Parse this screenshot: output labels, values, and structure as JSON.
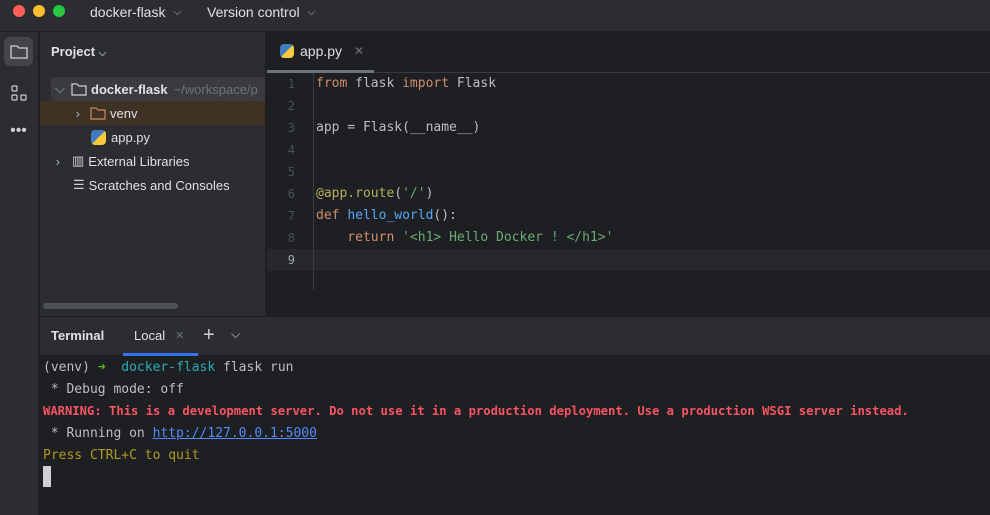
{
  "titlebar": {
    "project": "docker-flask",
    "vcs": "Version control"
  },
  "project_panel": {
    "title": "Project",
    "tree": [
      {
        "label": "docker-flask",
        "path": "~/workspace/p"
      },
      {
        "label": "venv"
      },
      {
        "label": "app.py"
      },
      {
        "label": "External Libraries"
      },
      {
        "label": "Scratches and Consoles"
      }
    ]
  },
  "editor": {
    "tab": "app.py",
    "line_numbers": [
      "1",
      "2",
      "3",
      "4",
      "5",
      "6",
      "7",
      "8",
      "9"
    ],
    "code": {
      "l1a": "from",
      "l1b": " flask ",
      "l1c": "import",
      "l1d": " Flask",
      "l3": "app = Flask(__name__)",
      "l6a": "@app.route",
      "l6b": "(",
      "l6c": "'/'",
      "l6d": ")",
      "l7a": "def",
      "l7b": " ",
      "l7c": "hello_world",
      "l7d": "():",
      "l8a": "    return",
      "l8b": " ",
      "l8c": "'<h1> Hello Docker ! </h1>'"
    }
  },
  "terminal": {
    "title": "Terminal",
    "tab": "Local",
    "prompt_env": "(venv) ",
    "prompt_arrow": "➜",
    "prompt_dir": "docker-flask",
    "prompt_cmd": " flask run",
    "line2": " * Debug mode: off",
    "line3": "WARNING: This is a development server. Do not use it in a production deployment. Use a production WSGI server instead.",
    "line4a": " * Running on ",
    "line4b": "http://127.0.0.1:5000",
    "line5": "Press CTRL+C to quit"
  },
  "colors": {
    "accent": "#3574f0",
    "warning": "#f75464",
    "link": "#548af7",
    "quit": "#b09a22"
  }
}
